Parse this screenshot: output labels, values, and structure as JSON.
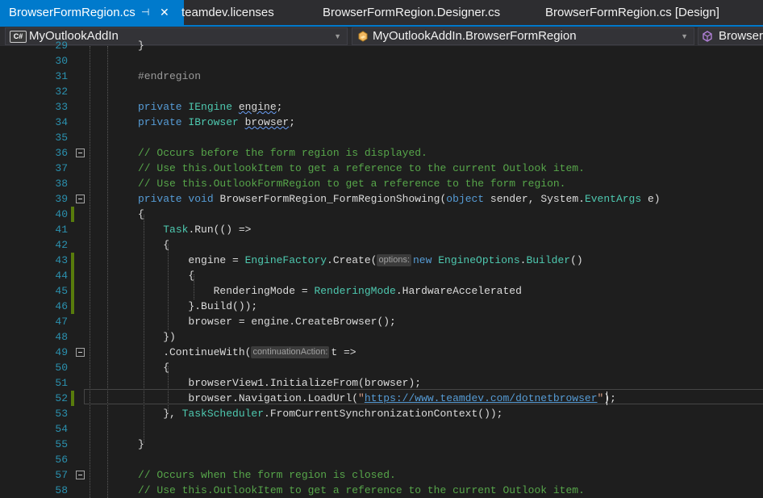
{
  "tabs": [
    {
      "label": "BrowserFormRegion.cs",
      "active": true,
      "pin": "⊣",
      "close": "✕"
    },
    {
      "label": "teamdev.licenses"
    },
    {
      "label": "BrowserFormRegion.Designer.cs"
    },
    {
      "label": "BrowserFormRegion.cs [Design]"
    }
  ],
  "navbar": {
    "project": "MyOutlookAddIn",
    "project_icon": "C#",
    "class": "MyOutlookAddIn.BrowserFormRegion",
    "member": "BrowserFormRegion"
  },
  "colors": {
    "accent": "#007acc",
    "keyword": "#569cd6",
    "type": "#4ec9b0",
    "comment": "#57a64a",
    "string": "#d69d85",
    "line_number": "#2b91af",
    "change_marker": "#587c0c"
  },
  "editor": {
    "lines": [
      {
        "n": "29",
        "tokens": [
          {
            "t": "}"
          }
        ]
      },
      {
        "n": "30",
        "tokens": []
      },
      {
        "n": "31",
        "tokens": [
          {
            "t": "#endregion",
            "c": "pp"
          }
        ]
      },
      {
        "n": "32",
        "tokens": []
      },
      {
        "n": "33",
        "tokens": [
          {
            "t": "private",
            "c": "kw"
          },
          {
            "t": " IEngine ",
            "c": "ty"
          },
          {
            "t": "engine",
            "c": "sq"
          },
          {
            "t": ";"
          }
        ]
      },
      {
        "n": "34",
        "tokens": [
          {
            "t": "private",
            "c": "kw"
          },
          {
            "t": " IBrowser ",
            "c": "ty"
          },
          {
            "t": "browser",
            "c": "sq"
          },
          {
            "t": ";"
          }
        ]
      },
      {
        "n": "35",
        "tokens": []
      },
      {
        "n": "36",
        "tokens": [
          {
            "t": "// Occurs before the form region is displayed.",
            "c": "cm"
          }
        ]
      },
      {
        "n": "37",
        "tokens": [
          {
            "t": "// Use this.OutlookItem to get a reference to the current Outlook item.",
            "c": "cm"
          }
        ]
      },
      {
        "n": "38",
        "tokens": [
          {
            "t": "// Use this.OutlookFormRegion to get a reference to the form region.",
            "c": "cm"
          }
        ]
      },
      {
        "n": "39",
        "tokens": [
          {
            "t": "private",
            "c": "kw"
          },
          {
            "t": " "
          },
          {
            "t": "void",
            "c": "kw"
          },
          {
            "t": " BrowserFormRegion_FormRegionShowing("
          },
          {
            "t": "object",
            "c": "kw"
          },
          {
            "t": " sender, System."
          },
          {
            "t": "EventArgs",
            "c": "ty"
          },
          {
            "t": " e)"
          }
        ]
      },
      {
        "n": "40",
        "tokens": [
          {
            "t": "{"
          }
        ]
      },
      {
        "n": "41",
        "tokens": [
          {
            "t": "    "
          },
          {
            "t": "Task",
            "c": "ty"
          },
          {
            "t": ".Run(() =>"
          }
        ]
      },
      {
        "n": "42",
        "tokens": [
          {
            "t": "    {"
          }
        ]
      },
      {
        "n": "43",
        "tokens": [
          {
            "t": "        engine = "
          },
          {
            "t": "EngineFactory",
            "c": "ty"
          },
          {
            "t": ".Create("
          },
          {
            "t": "options:",
            "c": "hint"
          },
          {
            "t": "new",
            "c": "kw"
          },
          {
            "t": " "
          },
          {
            "t": "EngineOptions",
            "c": "ty"
          },
          {
            "t": "."
          },
          {
            "t": "Builder",
            "c": "ty"
          },
          {
            "t": "()"
          }
        ]
      },
      {
        "n": "44",
        "tokens": [
          {
            "t": "        {"
          }
        ]
      },
      {
        "n": "45",
        "tokens": [
          {
            "t": "            RenderingMode = "
          },
          {
            "t": "RenderingMode",
            "c": "ty"
          },
          {
            "t": ".HardwareAccelerated"
          }
        ]
      },
      {
        "n": "46",
        "tokens": [
          {
            "t": "        }.Build());"
          }
        ]
      },
      {
        "n": "47",
        "tokens": [
          {
            "t": "        browser = engine.CreateBrowser();"
          }
        ]
      },
      {
        "n": "48",
        "tokens": [
          {
            "t": "    })"
          }
        ]
      },
      {
        "n": "49",
        "tokens": [
          {
            "t": "    .ContinueWith("
          },
          {
            "t": "continuationAction:",
            "c": "hint"
          },
          {
            "t": "t =>"
          }
        ]
      },
      {
        "n": "50",
        "tokens": [
          {
            "t": "    {"
          }
        ]
      },
      {
        "n": "51",
        "tokens": [
          {
            "t": "        browserView1.InitializeFrom(browser);"
          }
        ]
      },
      {
        "n": "52",
        "tokens": [
          {
            "t": "        browser.Navigation.LoadUrl("
          },
          {
            "t": "\"",
            "c": "st"
          },
          {
            "t": "https://www.teamdev.com/dotnetbrowser",
            "c": "lk"
          },
          {
            "t": "\"",
            "c": "st"
          },
          {
            "t": ");"
          }
        ]
      },
      {
        "n": "53",
        "tokens": [
          {
            "t": "    }, "
          },
          {
            "t": "TaskScheduler",
            "c": "ty"
          },
          {
            "t": ".FromCurrentSynchronizationContext());"
          }
        ]
      },
      {
        "n": "54",
        "tokens": []
      },
      {
        "n": "55",
        "tokens": [
          {
            "t": "}"
          }
        ]
      },
      {
        "n": "56",
        "tokens": []
      },
      {
        "n": "57",
        "tokens": [
          {
            "t": "// Occurs when the form region is closed.",
            "c": "cm"
          }
        ]
      },
      {
        "n": "58",
        "tokens": [
          {
            "t": "// Use this.OutlookItem to get a reference to the current Outlook item.",
            "c": "cm"
          }
        ]
      }
    ]
  }
}
